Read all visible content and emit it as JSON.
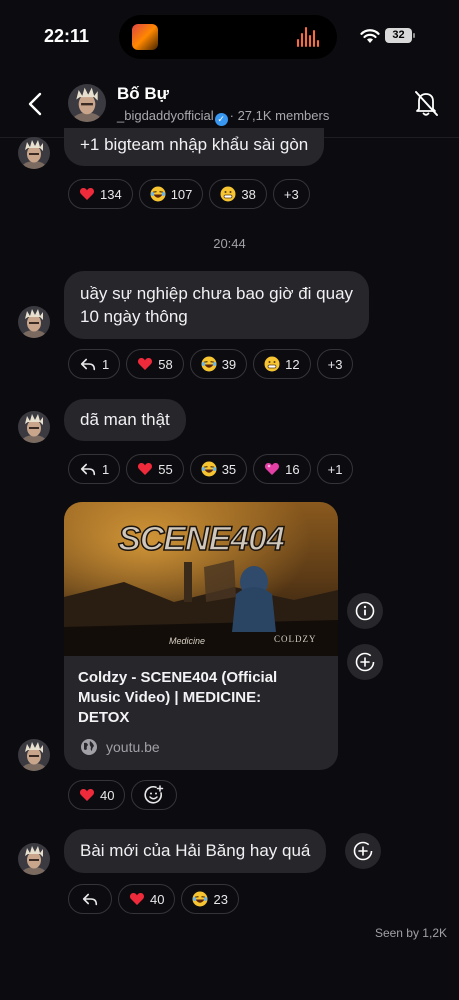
{
  "status": {
    "time": "22:11",
    "battery": "32"
  },
  "header": {
    "title": "Bố Bự",
    "handle": "_bigdaddyofficial",
    "members": "· 27,1K members"
  },
  "colors": {
    "accent": "#3897f0",
    "bubble": "#26262b",
    "background": "#0c0c10"
  },
  "messages": [
    {
      "text": "+1 bigteam nhập khẩu sài gòn",
      "reactions": [
        {
          "icon": "heart-emoji",
          "count": "134"
        },
        {
          "icon": "laughing-emoji",
          "count": "107"
        },
        {
          "icon": "grimace-emoji",
          "count": "38"
        },
        {
          "icon": "more",
          "count": "+3"
        }
      ]
    },
    {
      "timestamp": "20:44",
      "text_line1": "uầy sự nghiệp chưa bao giờ đi quay",
      "text_line2": "10 ngày thông",
      "reply_count": "1",
      "reactions": [
        {
          "icon": "heart-emoji",
          "count": "58"
        },
        {
          "icon": "laughing-emoji",
          "count": "39"
        },
        {
          "icon": "grimace-emoji",
          "count": "12"
        },
        {
          "icon": "more",
          "count": "+3"
        }
      ]
    },
    {
      "text": "dã man thật",
      "reply_count": "1",
      "reactions": [
        {
          "icon": "heart-emoji",
          "count": "55"
        },
        {
          "icon": "laughing-emoji",
          "count": "35"
        },
        {
          "icon": "pink-heart-emoji",
          "count": "16"
        },
        {
          "icon": "more",
          "count": "+1"
        }
      ]
    },
    {
      "link": {
        "thumb_title": "SCENE404",
        "thumb_brand": "COLDZY",
        "title_line1": "Coldzy - SCENE404 (Official",
        "title_line2": "Music Video) | MEDICINE:",
        "title_line3": "DETOX",
        "domain": "youtu.be"
      },
      "reactions": [
        {
          "icon": "heart-emoji",
          "count": "40"
        }
      ]
    },
    {
      "text": "Bài mới của Hải Băng hay quá",
      "reactions": [
        {
          "icon": "heart-emoji",
          "count": "40"
        },
        {
          "icon": "laughing-emoji",
          "count": "23"
        }
      ]
    }
  ],
  "footer": {
    "seen": "Seen by 1,2K"
  }
}
